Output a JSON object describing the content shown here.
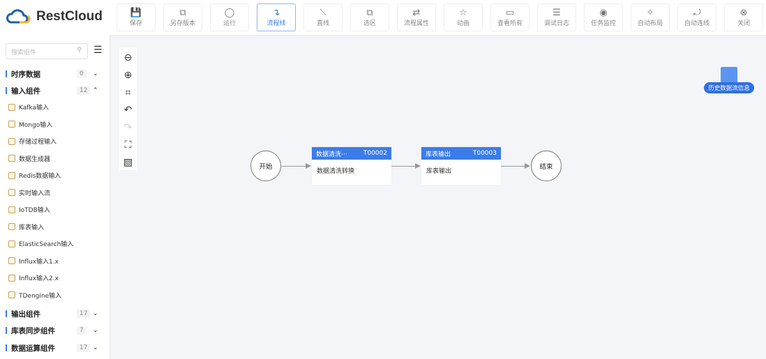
{
  "app": {
    "name": "RestCloud"
  },
  "toolbar": [
    {
      "label": "保存",
      "icon": "💾"
    },
    {
      "label": "另存版本",
      "icon": "⧉"
    },
    {
      "label": "运行",
      "icon": "◯"
    },
    {
      "label": "流程线",
      "icon": "↴",
      "active": true
    },
    {
      "label": "直线",
      "icon": "⟍"
    },
    {
      "label": "选区",
      "icon": "⧉"
    },
    {
      "label": "流程属性",
      "icon": "⇄"
    },
    {
      "label": "动画",
      "icon": "☆"
    },
    {
      "label": "查看所有",
      "icon": "▭"
    },
    {
      "label": "调试日志",
      "icon": "☰"
    },
    {
      "label": "任务监控",
      "icon": "◉"
    },
    {
      "label": "自动布局",
      "icon": "✧"
    },
    {
      "label": "自动连线",
      "icon": "⤾"
    },
    {
      "label": "关闭",
      "icon": "⊗"
    }
  ],
  "sidebar": {
    "search_placeholder": "搜索组件",
    "categories": [
      {
        "label": "时序数据",
        "count": "0",
        "chev": "⌄"
      },
      {
        "label": "输入组件",
        "count": "12",
        "chev": "⌃"
      },
      {
        "label": "输出组件",
        "count": "17",
        "chev": "⌄"
      },
      {
        "label": "库表同步组件",
        "count": "7",
        "chev": "⌄"
      },
      {
        "label": "数据运算组件",
        "count": "17",
        "chev": "⌄"
      }
    ],
    "items": [
      "Kafka输入",
      "Mongo输入",
      "存储过程输入",
      "数据生成器",
      "Redis数据输入",
      "实时输入流",
      "IoTDB输入",
      "库表输入",
      "ElasticSearch输入",
      "Influx输入1.x",
      "Influx输入2.x",
      "TDengine输入"
    ]
  },
  "flow": {
    "start": "开始",
    "end": "结束",
    "tasks": [
      {
        "title": "数据清洗···",
        "id": "T00002",
        "body": "数据清洗转换"
      },
      {
        "title": "库表输出",
        "id": "T00003",
        "body": "库表输出"
      }
    ]
  },
  "history_label": "历史数据流信息",
  "colors": {
    "accent": "#3b7ce8"
  }
}
